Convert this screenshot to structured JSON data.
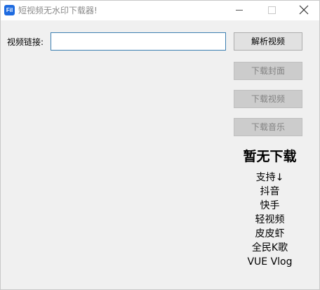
{
  "window": {
    "title": "短视频无水印下载器!",
    "icon_label": "Fil"
  },
  "form": {
    "url_label": "视频链接:",
    "url_value": "",
    "url_placeholder": ""
  },
  "buttons": {
    "parse": "解析视频",
    "download_cover": "下载封面",
    "download_video": "下载视频",
    "download_music": "下载音乐"
  },
  "status": {
    "text": "暂无下载"
  },
  "support": {
    "items": [
      "支持↓",
      "抖音",
      "快手",
      "轻视频",
      "皮皮虾",
      "全民K歌",
      "VUE Vlog"
    ]
  },
  "colors": {
    "accent": "#3c7fb1",
    "icon_bg": "#1e6be0",
    "window_bg": "#f0f0f0"
  }
}
